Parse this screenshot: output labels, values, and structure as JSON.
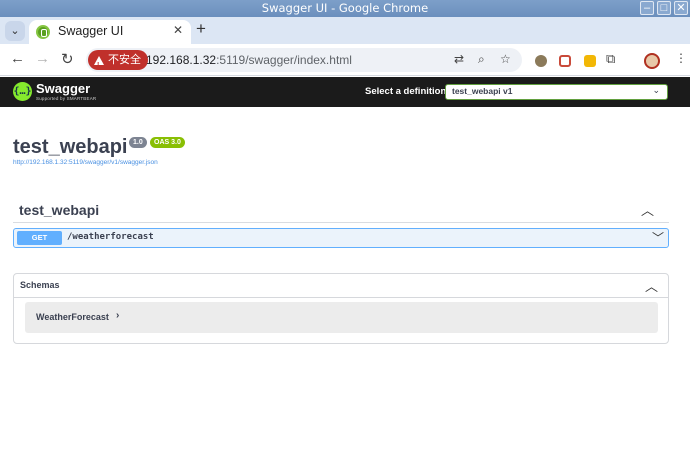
{
  "os": {
    "window_title": "Swagger UI - Google Chrome"
  },
  "browser": {
    "tab_title": "Swagger UI",
    "security_label": "不安全",
    "url_host": "192.168.1.32",
    "url_rest": ":5119/swagger/index.html"
  },
  "swagger": {
    "brand": "Swagger",
    "brand_sub": "Supported by SMARTBEAR",
    "definition_label": "Select a definition",
    "definition_value": "test_webapi v1"
  },
  "info": {
    "title": "test_webapi",
    "version": "1.0",
    "oas": "OAS 3.0",
    "spec_url": "http://192.168.1.32:5119/swagger/v1/swagger.json"
  },
  "tag": {
    "name": "test_webapi",
    "operations": [
      {
        "method": "GET",
        "path": "/weatherforecast"
      }
    ]
  },
  "schemas": {
    "title": "Schemas",
    "models": [
      "WeatherForecast"
    ]
  },
  "colors": {
    "get_method": "#61affe",
    "oas_badge": "#89bf04",
    "insecure_chip": "#c0302b"
  }
}
